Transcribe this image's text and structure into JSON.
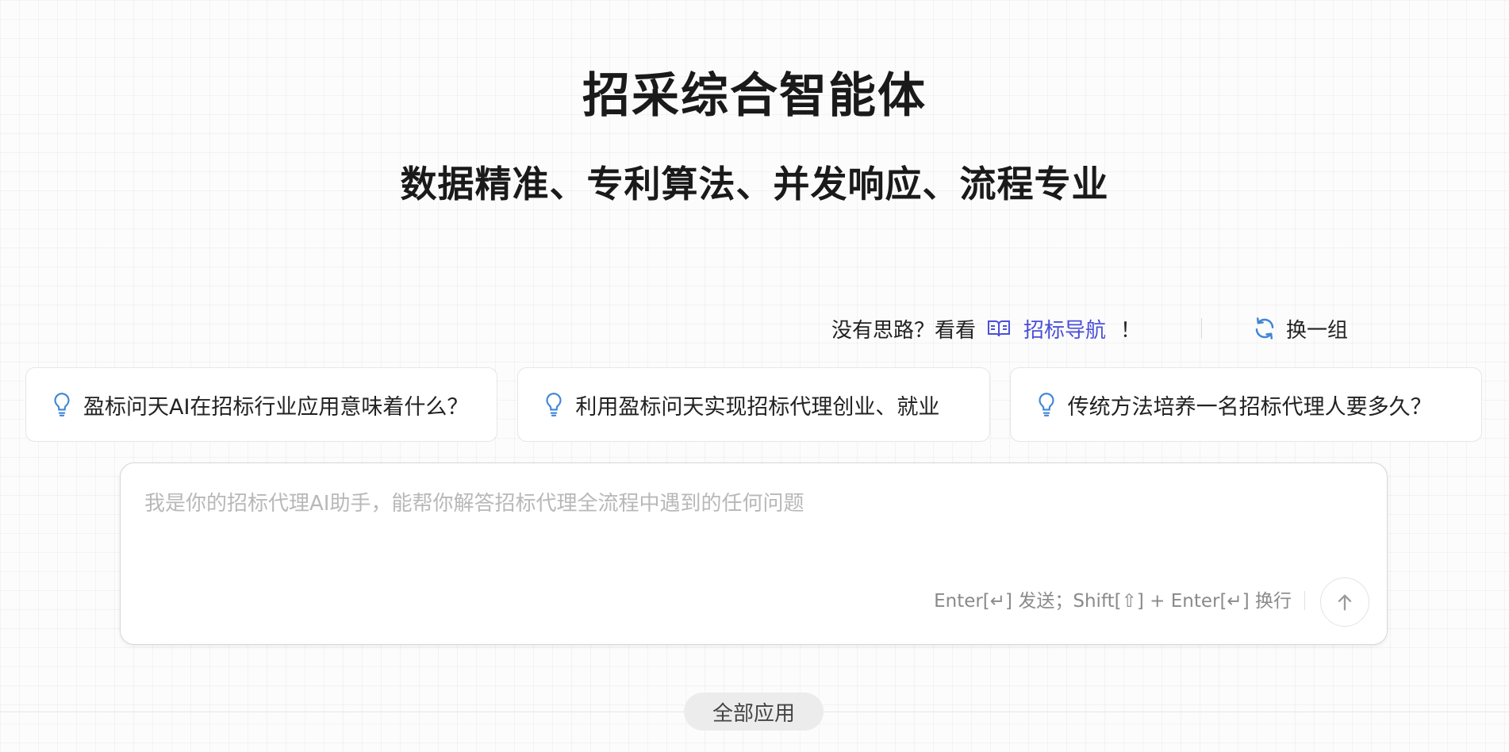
{
  "header": {
    "title": "招采综合智能体",
    "subtitle": "数据精准、专利算法、并发响应、流程专业"
  },
  "hint": {
    "prefix": "没有思路？看看",
    "nav_label": "招标导航",
    "suffix": "！",
    "refresh_label": "换一组"
  },
  "suggestions": [
    {
      "label": "盈标问天AI在招标行业应用意味着什么？"
    },
    {
      "label": "利用盈标问天实现招标代理创业、就业"
    },
    {
      "label": "传统方法培养一名招标代理人要多久？"
    }
  ],
  "input": {
    "placeholder": "我是你的招标代理AI助手，能帮你解答招标代理全流程中遇到的任何问题",
    "value": "",
    "shortcut_hint": "Enter[↵] 发送；Shift[⇧] + Enter[↵] 换行"
  },
  "footer": {
    "all_apps_label": "全部应用"
  },
  "colors": {
    "accent": "#4a4fd8",
    "icon_blue": "#3f86d6"
  }
}
